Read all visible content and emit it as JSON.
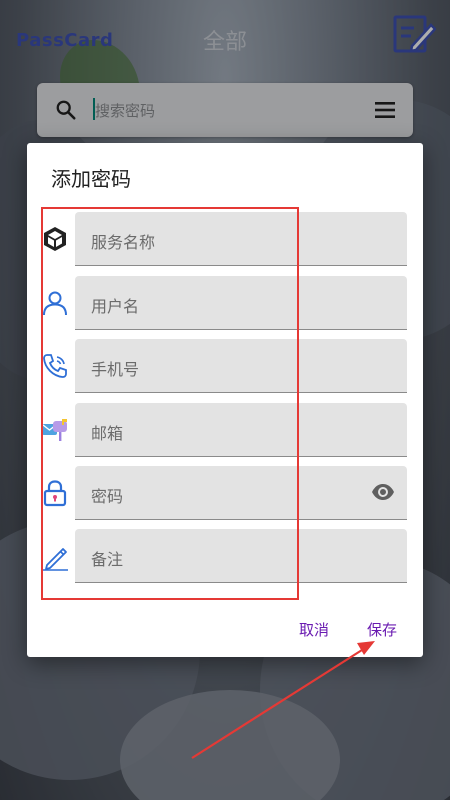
{
  "app": {
    "name": "PassCard",
    "page_title": "全部"
  },
  "search": {
    "placeholder": "搜索密码"
  },
  "icons": {
    "edit": "edit-square-icon",
    "search": "search-icon",
    "menu": "hamburger-menu-icon",
    "service": "cube-icon",
    "user": "person-icon",
    "phone": "phone-icon",
    "email": "mailbox-icon",
    "password": "lock-icon",
    "notes": "pencil-icon",
    "visibility": "eye-icon"
  },
  "dialog": {
    "title": "添加密码",
    "fields": [
      {
        "label": "服务名称",
        "icon": "cube-icon"
      },
      {
        "label": "用户名",
        "icon": "person-icon"
      },
      {
        "label": "手机号",
        "icon": "phone-icon"
      },
      {
        "label": "邮箱",
        "icon": "mailbox-icon"
      },
      {
        "label": "密码",
        "icon": "lock-icon",
        "has_visibility_toggle": true
      },
      {
        "label": "备注",
        "icon": "pencil-icon"
      }
    ],
    "actions": {
      "cancel": "取消",
      "save": "保存"
    }
  },
  "colors": {
    "accent": "#6a1bb1",
    "app_name": "#3f51b5",
    "annotation": "#e53935",
    "field_bg": "#e3e3e3"
  }
}
